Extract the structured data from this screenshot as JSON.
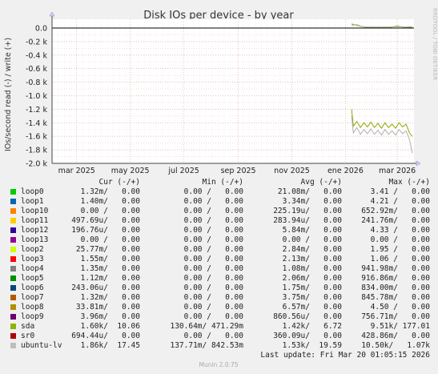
{
  "chart_data": {
    "type": "line",
    "title": "Disk IOs per device - by year",
    "ylabel": "IOs/second read (-) / write (+)",
    "ylim": [
      -2.0,
      0.2
    ],
    "yticks": [
      "0.0",
      "-0.2 k",
      "-0.4 k",
      "-0.6 k",
      "-0.8 k",
      "-1.0 k",
      "-1.2 k",
      "-1.4 k",
      "-1.6 k",
      "-1.8 k",
      "-2.0 k"
    ],
    "ytick_values": [
      0,
      -0.2,
      -0.4,
      -0.6,
      -0.8,
      -1.0,
      -1.2,
      -1.4,
      -1.6,
      -1.8,
      -2.0
    ],
    "xlim": [
      "2025-02-01",
      "2026-03-20"
    ],
    "xticks": [
      {
        "label": "mar 2025",
        "date": "2025-03-01"
      },
      {
        "label": "may 2025",
        "date": "2025-05-01"
      },
      {
        "label": "jul 2025",
        "date": "2025-07-01"
      },
      {
        "label": "sep 2025",
        "date": "2025-09-01"
      },
      {
        "label": "nov 2025",
        "date": "2025-11-01"
      },
      {
        "label": "ene 2026",
        "date": "2026-01-01"
      },
      {
        "label": "mar 2026",
        "date": "2026-03-01"
      }
    ],
    "grid": true,
    "series": [
      {
        "name": "sda",
        "color": "#8fa800",
        "points": [
          [
            "2026-01-08",
            -1.2
          ],
          [
            "2026-01-10",
            -1.45
          ],
          [
            "2026-01-14",
            -1.38
          ],
          [
            "2026-01-18",
            -1.47
          ],
          [
            "2026-01-22",
            -1.4
          ],
          [
            "2026-01-26",
            -1.46
          ],
          [
            "2026-01-30",
            -1.39
          ],
          [
            "2026-02-03",
            -1.47
          ],
          [
            "2026-02-07",
            -1.41
          ],
          [
            "2026-02-11",
            -1.48
          ],
          [
            "2026-02-15",
            -1.4
          ],
          [
            "2026-02-19",
            -1.47
          ],
          [
            "2026-02-23",
            -1.42
          ],
          [
            "2026-02-27",
            -1.48
          ],
          [
            "2026-03-03",
            -1.4
          ],
          [
            "2026-03-07",
            -1.46
          ],
          [
            "2026-03-11",
            -1.42
          ],
          [
            "2026-03-15",
            -1.55
          ],
          [
            "2026-03-18",
            -1.6
          ]
        ]
      },
      {
        "name": "ubuntu-lv",
        "color": "#b0b0b0",
        "points": [
          [
            "2026-01-08",
            -1.3
          ],
          [
            "2026-01-10",
            -1.55
          ],
          [
            "2026-01-14",
            -1.47
          ],
          [
            "2026-01-18",
            -1.57
          ],
          [
            "2026-01-22",
            -1.5
          ],
          [
            "2026-01-26",
            -1.56
          ],
          [
            "2026-01-30",
            -1.49
          ],
          [
            "2026-02-03",
            -1.57
          ],
          [
            "2026-02-07",
            -1.51
          ],
          [
            "2026-02-11",
            -1.58
          ],
          [
            "2026-02-15",
            -1.5
          ],
          [
            "2026-02-19",
            -1.57
          ],
          [
            "2026-02-23",
            -1.52
          ],
          [
            "2026-02-27",
            -1.58
          ],
          [
            "2026-03-03",
            -1.5
          ],
          [
            "2026-03-07",
            -1.56
          ],
          [
            "2026-03-11",
            -1.52
          ],
          [
            "2026-03-15",
            -1.65
          ],
          [
            "2026-03-18",
            -1.85
          ]
        ]
      },
      {
        "name": "sda",
        "color": "#8fa800",
        "points": [
          [
            "2026-01-08",
            0.06
          ],
          [
            "2026-01-14",
            0.04
          ],
          [
            "2026-01-20",
            0.02
          ],
          [
            "2026-01-26",
            0.01
          ],
          [
            "2026-02-05",
            0.01
          ],
          [
            "2026-02-20",
            0.01
          ],
          [
            "2026-03-01",
            0.03
          ],
          [
            "2026-03-10",
            0.01
          ],
          [
            "2026-03-18",
            0.01
          ]
        ]
      },
      {
        "name": "ubuntu-lv",
        "color": "#b0b0b0",
        "points": [
          [
            "2026-01-08",
            0.04
          ],
          [
            "2026-01-14",
            0.05
          ],
          [
            "2026-01-20",
            0.02
          ],
          [
            "2026-01-26",
            0.015
          ],
          [
            "2026-02-05",
            0.015
          ],
          [
            "2026-02-20",
            0.015
          ],
          [
            "2026-03-01",
            0.02
          ],
          [
            "2026-03-10",
            0.015
          ],
          [
            "2026-03-18",
            0.02
          ]
        ]
      }
    ]
  },
  "side_label": "RRDTOOL / TOBI OETIKER",
  "legend": {
    "headers": {
      "cur": "Cur (-/+)",
      "min": "Min (-/+)",
      "avg": "Avg (-/+)",
      "max": "Max (-/+)"
    },
    "rows": [
      {
        "name": "loop0",
        "color": "#00cc00",
        "cur": "1.32m/   0.00",
        "min": "0.00 /   0.00",
        "avg": "21.08m/   0.00",
        "max": "3.41 /   0.00"
      },
      {
        "name": "loop1",
        "color": "#0066b3",
        "cur": "1.40m/   0.00",
        "min": "0.00 /   0.00",
        "avg": "3.34m/   0.00",
        "max": "4.21 /   0.00"
      },
      {
        "name": "loop10",
        "color": "#ff8000",
        "cur": "0.00 /   0.00",
        "min": "0.00 /   0.00",
        "avg": "225.19u/   0.00",
        "max": "652.92m/   0.00"
      },
      {
        "name": "loop11",
        "color": "#ffcc00",
        "cur": "497.69u/   0.00",
        "min": "0.00 /   0.00",
        "avg": "283.94u/   0.00",
        "max": "241.76m/   0.00"
      },
      {
        "name": "loop12",
        "color": "#330099",
        "cur": "196.76u/   0.00",
        "min": "0.00 /   0.00",
        "avg": "5.84m/   0.00",
        "max": "4.33 /   0.00"
      },
      {
        "name": "loop13",
        "color": "#990099",
        "cur": "0.00 /   0.00",
        "min": "0.00 /   0.00",
        "avg": "0.00 /   0.00",
        "max": "0.00 /   0.00"
      },
      {
        "name": "loop2",
        "color": "#ccff00",
        "cur": "25.77m/   0.00",
        "min": "0.00 /   0.00",
        "avg": "2.84m/   0.00",
        "max": "1.95 /   0.00"
      },
      {
        "name": "loop3",
        "color": "#ff0000",
        "cur": "1.55m/   0.00",
        "min": "0.00 /   0.00",
        "avg": "2.13m/   0.00",
        "max": "1.06 /   0.00"
      },
      {
        "name": "loop4",
        "color": "#808080",
        "cur": "1.35m/   0.00",
        "min": "0.00 /   0.00",
        "avg": "1.08m/   0.00",
        "max": "941.98m/   0.00"
      },
      {
        "name": "loop5",
        "color": "#008f00",
        "cur": "1.12m/   0.00",
        "min": "0.00 /   0.00",
        "avg": "2.06m/   0.00",
        "max": "916.86m/   0.00"
      },
      {
        "name": "loop6",
        "color": "#00487d",
        "cur": "243.06u/   0.00",
        "min": "0.00 /   0.00",
        "avg": "1.75m/   0.00",
        "max": "834.00m/   0.00"
      },
      {
        "name": "loop7",
        "color": "#b35a00",
        "cur": "1.32m/   0.00",
        "min": "0.00 /   0.00",
        "avg": "3.75m/   0.00",
        "max": "845.78m/   0.00"
      },
      {
        "name": "loop8",
        "color": "#b38f00",
        "cur": "33.81m/   0.00",
        "min": "0.00 /   0.00",
        "avg": "6.57m/   0.00",
        "max": "4.50 /   0.00"
      },
      {
        "name": "loop9",
        "color": "#6b006b",
        "cur": "3.96m/   0.00",
        "min": "0.00 /   0.00",
        "avg": "860.56u/   0.00",
        "max": "756.71m/   0.00"
      },
      {
        "name": "sda",
        "color": "#8fb300",
        "cur": "1.60k/  10.06",
        "min": "130.64m/ 471.29m",
        "avg": "1.42k/   6.72",
        "max": "9.51k/ 177.01"
      },
      {
        "name": "sr0",
        "color": "#b30000",
        "cur": "694.44u/   0.00",
        "min": "0.00 /   0.00",
        "avg": "360.09u/   0.00",
        "max": "428.86m/   0.00"
      },
      {
        "name": "ubuntu-lv",
        "color": "#bebebe",
        "cur": "1.86k/  17.45",
        "min": "137.71m/ 842.53m",
        "avg": "1.53k/  19.59",
        "max": "10.50k/   1.07k"
      }
    ]
  },
  "last_update": "Last update: Fri Mar 20 01:05:15 2026",
  "footer": "Munin 2.0.75"
}
